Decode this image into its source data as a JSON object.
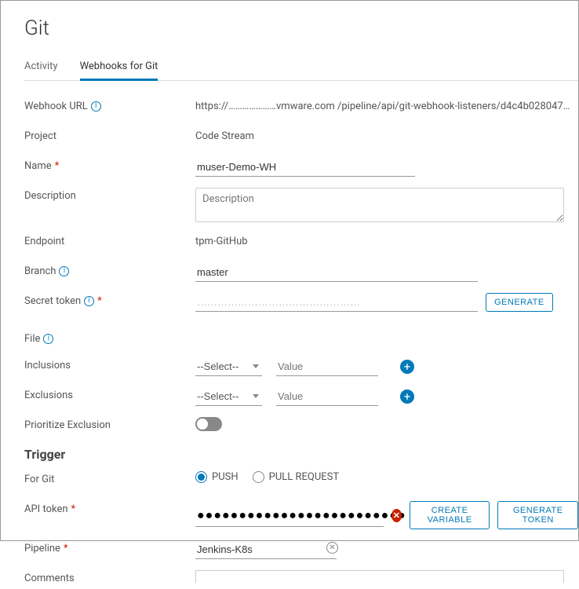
{
  "title": "Git",
  "tabs": {
    "activity": "Activity",
    "webhooks": "Webhooks for Git",
    "active": "webhooks"
  },
  "labels": {
    "webhookUrl": "Webhook URL",
    "project": "Project",
    "name": "Name",
    "description": "Description",
    "endpoint": "Endpoint",
    "branch": "Branch",
    "secret": "Secret token",
    "file": "File",
    "inclusions": "Inclusions",
    "exclusions": "Exclusions",
    "prioritize": "Prioritize Exclusion",
    "trigger": "Trigger",
    "forGit": "For Git",
    "apiToken": "API token",
    "pipeline": "Pipeline",
    "comments": "Comments"
  },
  "values": {
    "webhookUrl": "https://…………………vmware.com /pipeline/api/git-webhook-listeners/d4c4b028047…",
    "project": "Code Stream",
    "name": "muser-Demo-WH",
    "descriptionPlaceholder": "Description",
    "endpoint": "tpm-GitHub",
    "branch": "master",
    "secret": "…………………………………………",
    "selectPlaceholder": "--Select--",
    "valuePlaceholder": "Value",
    "pipeline": "Jenkins-K8s",
    "apiTokenMask": "●●●●●●●●●●●●●●●●●●●●●●●●●"
  },
  "buttons": {
    "generate": "GENERATE",
    "createVariable": "CREATE VARIABLE",
    "generateToken": "GENERATE TOKEN"
  },
  "radios": {
    "push": "PUSH",
    "pullRequest": "PULL REQUEST",
    "selected": "push"
  }
}
